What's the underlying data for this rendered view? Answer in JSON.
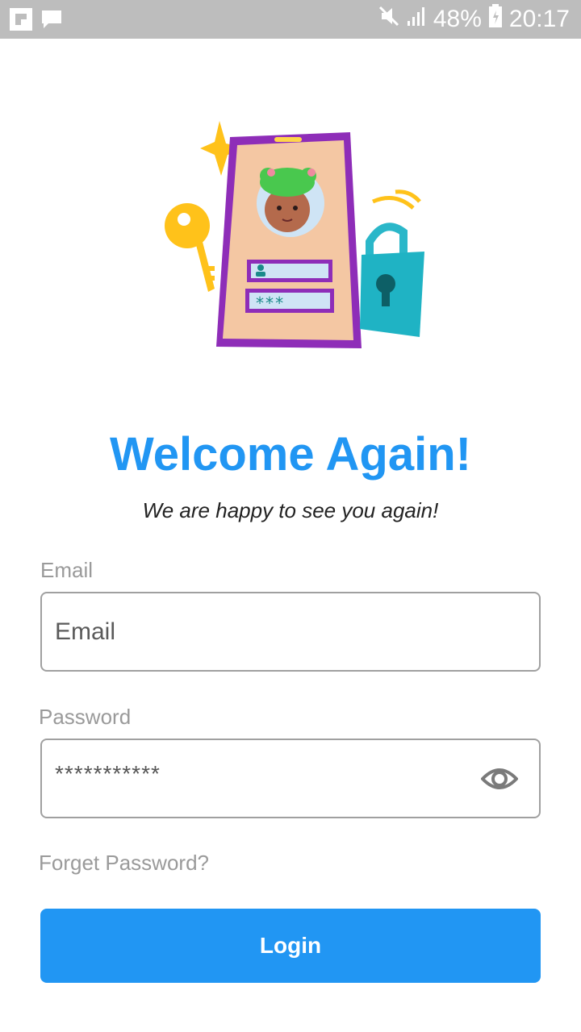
{
  "status_bar": {
    "battery": "48%",
    "time": "20:17",
    "icons": [
      "flipboard-icon",
      "message-icon",
      "mute-icon",
      "signal-icon",
      "battery-icon"
    ]
  },
  "hero": {
    "illustration": "login-illustration",
    "password_mask": "***"
  },
  "header": {
    "title": "Welcome Again!",
    "subtitle": "We are happy to see you again!"
  },
  "form": {
    "email": {
      "label": "Email",
      "placeholder": "Email",
      "value": ""
    },
    "password": {
      "label": "Password",
      "value": "***********",
      "toggle_icon": "eye-icon"
    },
    "forgot_label": "Forget Password?",
    "login_label": "Login"
  },
  "colors": {
    "accent": "#2196f3",
    "status_bar": "#bdbdbd",
    "label": "#9a9a9a"
  }
}
